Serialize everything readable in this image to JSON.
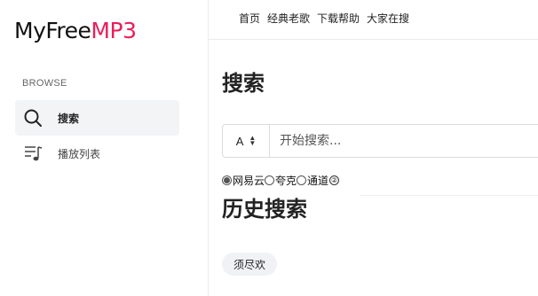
{
  "logo": {
    "part1": "MyFree",
    "part2": "MP3",
    "accent_color": "#ec1c5b"
  },
  "sidebar": {
    "section_label": "BROWSE",
    "items": [
      {
        "label": "搜索",
        "icon": "search-icon",
        "active": true
      },
      {
        "label": "播放列表",
        "icon": "playlist-icon",
        "active": false
      }
    ]
  },
  "topnav": {
    "items": [
      {
        "label": "首页"
      },
      {
        "label": "经典老歌"
      },
      {
        "label": "下载帮助"
      },
      {
        "label": "大家在搜"
      }
    ]
  },
  "main": {
    "title": "搜索",
    "search": {
      "select_value": "A",
      "placeholder": "开始搜索..."
    },
    "sources": [
      {
        "label": "网易云",
        "checked": true
      },
      {
        "label": "夸克",
        "checked": false
      },
      {
        "label": "通道",
        "checked": false
      }
    ],
    "help_icon": "②",
    "history_title": "历史搜索",
    "history_items": [
      {
        "label": "须尽欢"
      }
    ]
  }
}
